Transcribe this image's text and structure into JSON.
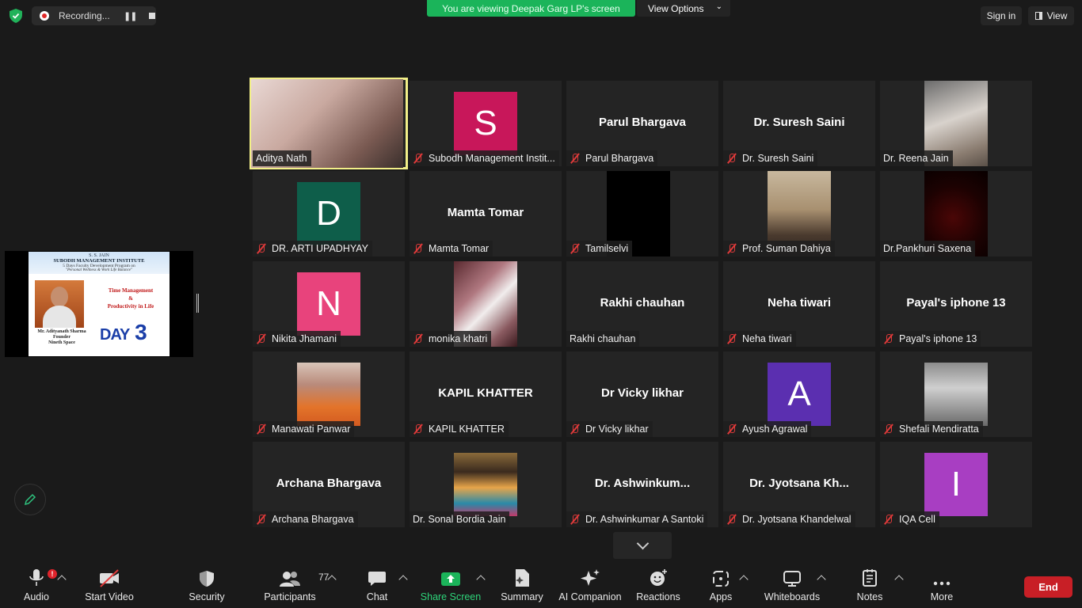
{
  "top": {
    "recording_label": "Recording...",
    "viewing_banner": "You are viewing Deepak Garg LP's screen",
    "view_options": "View Options",
    "sign_in": "Sign in",
    "view": "View"
  },
  "slide": {
    "line1": "S. S. JAIN",
    "line2": "SUBODH MANAGEMENT INSTITUTE",
    "line3": "5 Days Faculty Development Program on",
    "line4": "\"Personal Wellness & Work Life Balance\"",
    "topic1": "Time Management",
    "topic2": "&",
    "topic3": "Productivity in Life",
    "cap1": "Mr. Adityanath Sharma",
    "cap2": "Founder",
    "cap3": "Nineth Space",
    "day": "DAY",
    "day_num": "3"
  },
  "participants_grid": [
    {
      "name": "Aditya Nath",
      "muted": false,
      "kind": "video"
    },
    {
      "name": "Subodh Management Instit...",
      "muted": true,
      "kind": "avatar",
      "initial": "S",
      "color": "#c8175a"
    },
    {
      "name": "Parul Bhargava",
      "muted": true,
      "kind": "text",
      "big": "Parul Bhargava"
    },
    {
      "name": "Dr. Suresh Saini",
      "muted": true,
      "kind": "text",
      "big": "Dr. Suresh Saini"
    },
    {
      "name": "Dr. Reena Jain",
      "muted": false,
      "kind": "video"
    },
    {
      "name": "DR. ARTI UPADHYAY",
      "muted": true,
      "kind": "avatar",
      "initial": "D",
      "color": "#0e5e4a"
    },
    {
      "name": "Mamta Tomar",
      "muted": true,
      "kind": "text",
      "big": "Mamta Tomar"
    },
    {
      "name": "Tamilselvi",
      "muted": true,
      "kind": "video"
    },
    {
      "name": "Prof. Suman Dahiya",
      "muted": true,
      "kind": "video"
    },
    {
      "name": "Dr.Pankhuri Saxena",
      "muted": false,
      "kind": "video"
    },
    {
      "name": "Nikita Jhamani",
      "muted": true,
      "kind": "avatar",
      "initial": "N",
      "color": "#e8437c"
    },
    {
      "name": "monika khatri",
      "muted": true,
      "kind": "video"
    },
    {
      "name": "Rakhi chauhan",
      "muted": false,
      "kind": "text",
      "big": "Rakhi chauhan"
    },
    {
      "name": "Neha tiwari",
      "muted": true,
      "kind": "text",
      "big": "Neha tiwari"
    },
    {
      "name": "Payal's iphone 13",
      "muted": true,
      "kind": "text",
      "big": "Payal's iphone 13"
    },
    {
      "name": "Manawati Panwar",
      "muted": true,
      "kind": "video"
    },
    {
      "name": "KAPIL KHATTER",
      "muted": true,
      "kind": "text",
      "big": "KAPIL KHATTER"
    },
    {
      "name": "Dr Vicky likhar",
      "muted": true,
      "kind": "text",
      "big": "Dr Vicky likhar"
    },
    {
      "name": "Ayush Agrawal",
      "muted": true,
      "kind": "avatar",
      "initial": "A",
      "color": "#5b2fb0"
    },
    {
      "name": "Shefali Mendiratta",
      "muted": true,
      "kind": "video"
    },
    {
      "name": "Archana Bhargava",
      "muted": true,
      "kind": "text",
      "big": "Archana Bhargava"
    },
    {
      "name": "Dr.  Sonal Bordia Jain",
      "muted": false,
      "kind": "video"
    },
    {
      "name": "Dr. Ashwinkumar A Santoki",
      "muted": true,
      "kind": "text",
      "big": "Dr.  Ashwinkum..."
    },
    {
      "name": "Dr. Jyotsana Khandelwal",
      "muted": true,
      "kind": "text",
      "big": "Dr. Jyotsana Kh..."
    },
    {
      "name": "IQA Cell",
      "muted": true,
      "kind": "avatar",
      "initial": "I",
      "color": "#a83ec2"
    }
  ],
  "toolbar": {
    "audio": "Audio",
    "start_video": "Start Video",
    "security": "Security",
    "participants": "Participants",
    "participants_count": "77",
    "chat": "Chat",
    "share_screen": "Share Screen",
    "summary": "Summary",
    "ai_companion": "AI Companion",
    "reactions": "Reactions",
    "apps": "Apps",
    "whiteboards": "Whiteboards",
    "notes": "Notes",
    "more": "More",
    "end": "End",
    "audio_badge": "!"
  },
  "colors": {
    "banner_green": "#1bb45a",
    "end_red": "#c81f26",
    "active_speaker": "#f3f089"
  }
}
